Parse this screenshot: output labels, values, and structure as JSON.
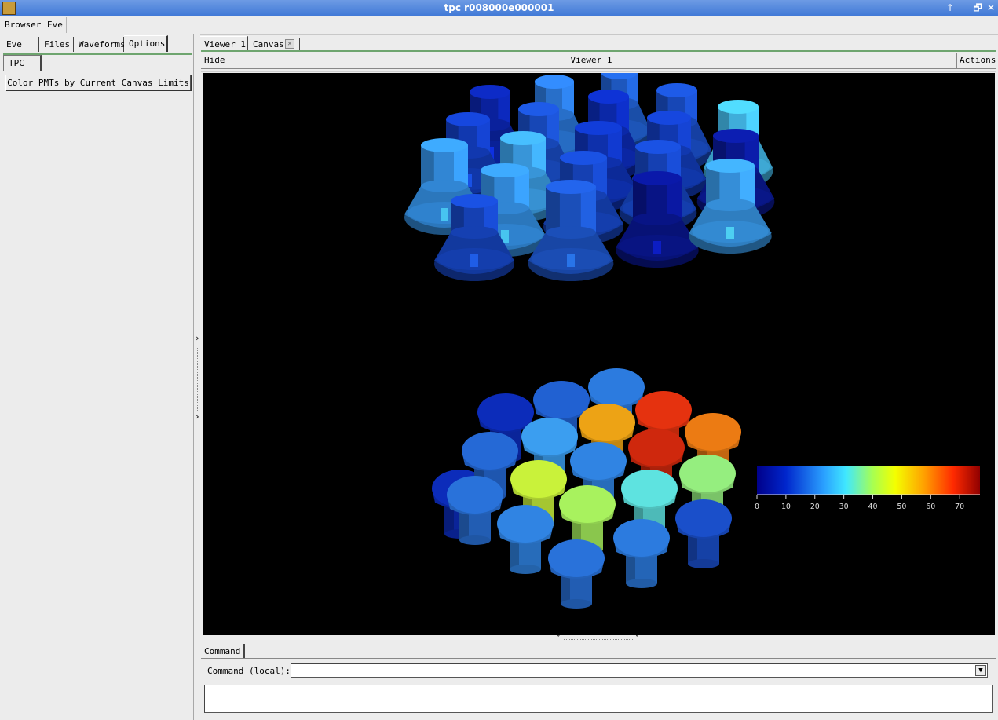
{
  "window": {
    "title": "tpc r008000e000001",
    "controls": [
      "↑",
      "_",
      "🗗",
      "✕"
    ]
  },
  "menubar": {
    "items": [
      "Browser",
      "Eve"
    ]
  },
  "left_panel": {
    "tabs": [
      "Eve",
      "Files",
      "Waveforms",
      "Options"
    ],
    "active_tab": "Options",
    "subtabs": [
      "TPC"
    ],
    "button_label": "Color PMTs by Current Canvas Limits"
  },
  "viewer": {
    "tabs": [
      "Viewer 1",
      "Canvas"
    ],
    "active_tab": "Viewer 1",
    "hide_label": "Hide",
    "title": "Viewer 1",
    "actions_label": "Actions"
  },
  "palette": {
    "ticks": [
      "0",
      "10",
      "20",
      "30",
      "40",
      "50",
      "60",
      "70"
    ],
    "min": 0,
    "max": 77
  },
  "command": {
    "tab_label": "Command",
    "label": "Command (local):",
    "value": "",
    "output": ""
  },
  "pmts_top": [
    {
      "id": 1,
      "value": 8
    },
    {
      "id": 2,
      "value": 19
    },
    {
      "id": 3,
      "value": 16
    },
    {
      "id": 4,
      "value": 14
    },
    {
      "id": 5,
      "value": 12
    },
    {
      "id": 6,
      "value": 14
    },
    {
      "id": 7,
      "value": 10
    },
    {
      "id": 8,
      "value": 12
    },
    {
      "id": 9,
      "value": 27
    },
    {
      "id": 10,
      "value": 24
    },
    {
      "id": 11,
      "value": 11
    },
    {
      "id": 12,
      "value": 13
    },
    {
      "id": 13,
      "value": 5
    },
    {
      "id": 14,
      "value": 22
    },
    {
      "id": 15,
      "value": 22
    },
    {
      "id": 16,
      "value": 13
    },
    {
      "id": 17,
      "value": 4
    },
    {
      "id": 18,
      "value": 23
    },
    {
      "id": 19,
      "value": 15
    },
    {
      "id": 20,
      "value": 13
    }
  ],
  "pmts_bottom": [
    {
      "id": 1,
      "value": 10
    },
    {
      "id": 2,
      "value": 16
    },
    {
      "id": 3,
      "value": 19
    },
    {
      "id": 4,
      "value": 68
    },
    {
      "id": 5,
      "value": 57
    },
    {
      "id": 6,
      "value": 61
    },
    {
      "id": 7,
      "value": 17
    },
    {
      "id": 8,
      "value": 23
    },
    {
      "id": 9,
      "value": 20
    },
    {
      "id": 10,
      "value": 70
    },
    {
      "id": 11,
      "value": 44
    },
    {
      "id": 12,
      "value": 38
    },
    {
      "id": 13,
      "value": 18
    },
    {
      "id": 14,
      "value": 32
    },
    {
      "id": 15,
      "value": 40
    },
    {
      "id": 16,
      "value": 20
    },
    {
      "id": 17,
      "value": 14
    },
    {
      "id": 18,
      "value": 19
    },
    {
      "id": 19,
      "value": 18
    },
    {
      "id": 20,
      "value": 10
    }
  ]
}
